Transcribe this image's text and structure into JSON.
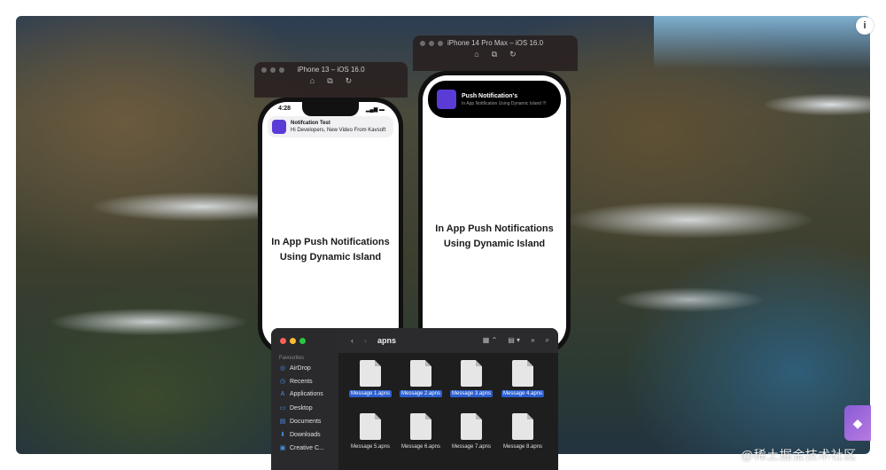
{
  "simulator_small": {
    "title": "iPhone 13 – iOS 16.0",
    "tools": [
      "⌂",
      "⧉",
      "↻"
    ]
  },
  "simulator_large": {
    "title": "iPhone 14 Pro Max – iOS 16.0",
    "tools": [
      "⌂",
      "⧉",
      "↻"
    ]
  },
  "phone_small": {
    "status_time": "4:28",
    "status_icons": "▂▄▆ ▬",
    "notification": {
      "title": "Notifcation Test",
      "body": "Hi Developers, New Video From Kavsoft"
    },
    "heading_line1": "In App Push Notifications",
    "heading_line2": "Using Dynamic Island"
  },
  "phone_large": {
    "island": {
      "title": "Push Notification's",
      "body": "In App Notification Using Dynamic Island !!!"
    },
    "heading_line1": "In App Push Notifications",
    "heading_line2": "Using Dynamic Island"
  },
  "finder": {
    "path": "apns",
    "favourites_label": "Favourites",
    "sidebar": [
      {
        "icon": "◎",
        "label": "AirDrop"
      },
      {
        "icon": "◷",
        "label": "Recents"
      },
      {
        "icon": "A",
        "label": "Applications"
      },
      {
        "icon": "▭",
        "label": "Desktop"
      },
      {
        "icon": "▤",
        "label": "Documents"
      },
      {
        "icon": "⬇",
        "label": "Downloads"
      },
      {
        "icon": "▣",
        "label": "Creative C..."
      }
    ],
    "files": [
      {
        "name": "Message 1.apns",
        "selected": true
      },
      {
        "name": "Message 2.apns",
        "selected": true
      },
      {
        "name": "Message 3.apns",
        "selected": true
      },
      {
        "name": "Message 4.apns",
        "selected": true
      },
      {
        "name": "Message 5.apns",
        "selected": false
      },
      {
        "name": "Message 6.apns",
        "selected": false
      },
      {
        "name": "Message 7.apns",
        "selected": false
      },
      {
        "name": "Message 8.apns",
        "selected": false
      }
    ],
    "toolbar_icons": {
      "back": "‹",
      "forward": "›",
      "grid": "▦ ⌃",
      "group": "▤ ▾",
      "more": "»",
      "search": "⌕"
    },
    "traffic_colors": [
      "#ff5f57",
      "#febc2e",
      "#28c840"
    ]
  },
  "info_button": "i",
  "watermark": "@稀土掘金技术社区"
}
